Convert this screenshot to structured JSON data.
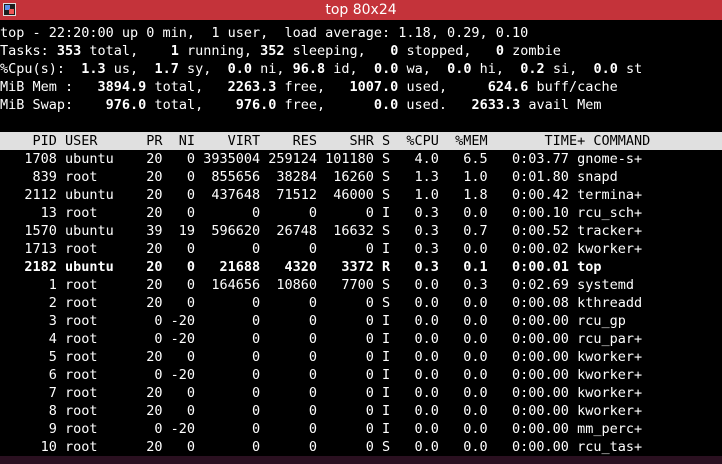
{
  "window": {
    "title": "top 80x24"
  },
  "summary": {
    "uptime_line": "top - 22:20:00 up 0 min,  1 user,  load average: 1.18, 0.29, 0.10",
    "tasks": {
      "label": "Tasks:",
      "total": "353",
      "running": "1",
      "sleeping": "352",
      "stopped": "0",
      "zombie": "0"
    },
    "cpu": {
      "label": "%Cpu(s):",
      "us": "1.3",
      "sy": "1.7",
      "ni": "0.0",
      "id": "96.8",
      "wa": "0.0",
      "hi": "0.0",
      "si": "0.2",
      "st": "0.0"
    },
    "mem": {
      "label": "MiB Mem :",
      "total": "3894.9",
      "free": "2263.3",
      "used": "1007.0",
      "buff_cache": "624.6"
    },
    "swap": {
      "label": "MiB Swap:",
      "total": "976.0",
      "free": "976.0",
      "used": "0.0",
      "avail_mem": "2633.3"
    }
  },
  "table": {
    "columns": [
      "PID",
      "USER",
      "PR",
      "NI",
      "VIRT",
      "RES",
      "SHR",
      "S",
      "%CPU",
      "%MEM",
      "TIME+",
      "COMMAND"
    ],
    "rows": [
      {
        "pid": "1708",
        "user": "ubuntu",
        "pr": "20",
        "ni": "0",
        "virt": "3935004",
        "res": "259124",
        "shr": "101180",
        "s": "S",
        "cpu": "4.0",
        "mem": "6.5",
        "time": "0:03.77",
        "cmd": "gnome-s+",
        "bold": false
      },
      {
        "pid": "839",
        "user": "root",
        "pr": "20",
        "ni": "0",
        "virt": "855656",
        "res": "38284",
        "shr": "16260",
        "s": "S",
        "cpu": "1.3",
        "mem": "1.0",
        "time": "0:01.80",
        "cmd": "snapd",
        "bold": false
      },
      {
        "pid": "2112",
        "user": "ubuntu",
        "pr": "20",
        "ni": "0",
        "virt": "437648",
        "res": "71512",
        "shr": "46000",
        "s": "S",
        "cpu": "1.0",
        "mem": "1.8",
        "time": "0:00.42",
        "cmd": "termina+",
        "bold": false
      },
      {
        "pid": "13",
        "user": "root",
        "pr": "20",
        "ni": "0",
        "virt": "0",
        "res": "0",
        "shr": "0",
        "s": "I",
        "cpu": "0.3",
        "mem": "0.0",
        "time": "0:00.10",
        "cmd": "rcu_sch+",
        "bold": false
      },
      {
        "pid": "1570",
        "user": "ubuntu",
        "pr": "39",
        "ni": "19",
        "virt": "596620",
        "res": "26748",
        "shr": "16632",
        "s": "S",
        "cpu": "0.3",
        "mem": "0.7",
        "time": "0:00.52",
        "cmd": "tracker+",
        "bold": false
      },
      {
        "pid": "1713",
        "user": "root",
        "pr": "20",
        "ni": "0",
        "virt": "0",
        "res": "0",
        "shr": "0",
        "s": "I",
        "cpu": "0.3",
        "mem": "0.0",
        "time": "0:00.02",
        "cmd": "kworker+",
        "bold": false
      },
      {
        "pid": "2182",
        "user": "ubuntu",
        "pr": "20",
        "ni": "0",
        "virt": "21688",
        "res": "4320",
        "shr": "3372",
        "s": "R",
        "cpu": "0.3",
        "mem": "0.1",
        "time": "0:00.01",
        "cmd": "top",
        "bold": true
      },
      {
        "pid": "1",
        "user": "root",
        "pr": "20",
        "ni": "0",
        "virt": "164656",
        "res": "10860",
        "shr": "7700",
        "s": "S",
        "cpu": "0.0",
        "mem": "0.3",
        "time": "0:02.69",
        "cmd": "systemd",
        "bold": false
      },
      {
        "pid": "2",
        "user": "root",
        "pr": "20",
        "ni": "0",
        "virt": "0",
        "res": "0",
        "shr": "0",
        "s": "S",
        "cpu": "0.0",
        "mem": "0.0",
        "time": "0:00.08",
        "cmd": "kthreadd",
        "bold": false
      },
      {
        "pid": "3",
        "user": "root",
        "pr": "0",
        "ni": "-20",
        "virt": "0",
        "res": "0",
        "shr": "0",
        "s": "I",
        "cpu": "0.0",
        "mem": "0.0",
        "time": "0:00.00",
        "cmd": "rcu_gp",
        "bold": false
      },
      {
        "pid": "4",
        "user": "root",
        "pr": "0",
        "ni": "-20",
        "virt": "0",
        "res": "0",
        "shr": "0",
        "s": "I",
        "cpu": "0.0",
        "mem": "0.0",
        "time": "0:00.00",
        "cmd": "rcu_par+",
        "bold": false
      },
      {
        "pid": "5",
        "user": "root",
        "pr": "20",
        "ni": "0",
        "virt": "0",
        "res": "0",
        "shr": "0",
        "s": "I",
        "cpu": "0.0",
        "mem": "0.0",
        "time": "0:00.00",
        "cmd": "kworker+",
        "bold": false
      },
      {
        "pid": "6",
        "user": "root",
        "pr": "0",
        "ni": "-20",
        "virt": "0",
        "res": "0",
        "shr": "0",
        "s": "I",
        "cpu": "0.0",
        "mem": "0.0",
        "time": "0:00.00",
        "cmd": "kworker+",
        "bold": false
      },
      {
        "pid": "7",
        "user": "root",
        "pr": "20",
        "ni": "0",
        "virt": "0",
        "res": "0",
        "shr": "0",
        "s": "I",
        "cpu": "0.0",
        "mem": "0.0",
        "time": "0:00.00",
        "cmd": "kworker+",
        "bold": false
      },
      {
        "pid": "8",
        "user": "root",
        "pr": "20",
        "ni": "0",
        "virt": "0",
        "res": "0",
        "shr": "0",
        "s": "I",
        "cpu": "0.0",
        "mem": "0.0",
        "time": "0:00.00",
        "cmd": "kworker+",
        "bold": false
      },
      {
        "pid": "9",
        "user": "root",
        "pr": "0",
        "ni": "-20",
        "virt": "0",
        "res": "0",
        "shr": "0",
        "s": "I",
        "cpu": "0.0",
        "mem": "0.0",
        "time": "0:00.00",
        "cmd": "mm_perc+",
        "bold": false
      },
      {
        "pid": "10",
        "user": "root",
        "pr": "20",
        "ni": "0",
        "virt": "0",
        "res": "0",
        "shr": "0",
        "s": "S",
        "cpu": "0.0",
        "mem": "0.0",
        "time": "0:00.00",
        "cmd": "rcu_tas+",
        "bold": false
      }
    ]
  },
  "colors": {
    "titlebar": "#c4333a",
    "background": "#000000",
    "foreground": "#ffffff",
    "header_bg": "#e0e0e0"
  }
}
